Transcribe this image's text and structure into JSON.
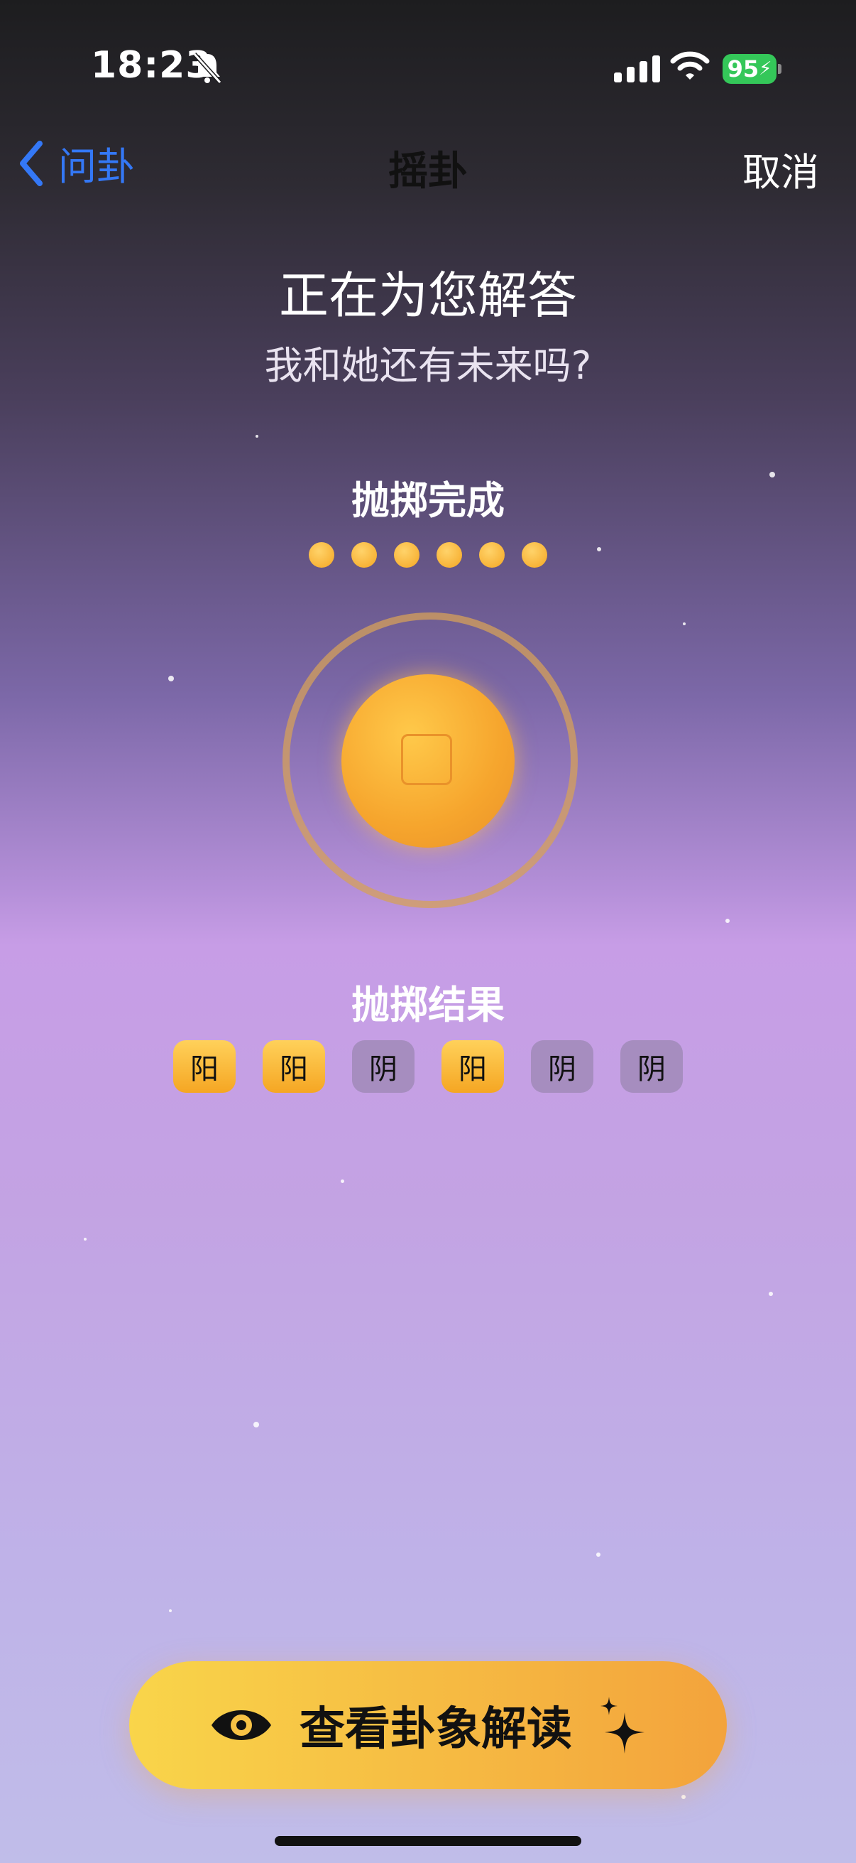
{
  "status_bar": {
    "time": "18:23",
    "battery": "95"
  },
  "nav": {
    "back_label": "问卦",
    "title": "摇卦",
    "cancel_label": "取消"
  },
  "header": {
    "title": "正在为您解答",
    "question": "我和她还有未来吗?"
  },
  "throw_section": {
    "label": "抛掷完成",
    "dots_count": 6
  },
  "result_section": {
    "label": "抛掷结果",
    "results": [
      "阳",
      "阳",
      "阴",
      "阳",
      "阴",
      "阴"
    ]
  },
  "cta": {
    "label": "查看卦象解读"
  },
  "colors": {
    "accent": "#3478f6",
    "gold": "#f5a623",
    "battery": "#34c759"
  }
}
